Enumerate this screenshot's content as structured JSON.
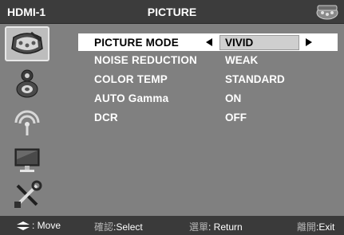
{
  "header": {
    "source": "HDMI-1",
    "title": "PICTURE"
  },
  "sidebar": {
    "items": [
      {
        "name": "picture",
        "icon": "palette-icon",
        "active": true
      },
      {
        "name": "sound",
        "icon": "speaker-icon",
        "active": false
      },
      {
        "name": "network",
        "icon": "broadcast-icon",
        "active": false
      },
      {
        "name": "display",
        "icon": "monitor-icon",
        "active": false
      },
      {
        "name": "setup",
        "icon": "tools-icon",
        "active": false
      }
    ]
  },
  "menu": {
    "items": [
      {
        "label": "PICTURE MODE",
        "value": "VIVID",
        "selected": true
      },
      {
        "label": "NOISE REDUCTION",
        "value": "WEAK",
        "selected": false
      },
      {
        "label": "COLOR TEMP",
        "value": "STANDARD",
        "selected": false
      },
      {
        "label": "AUTO Gamma",
        "value": "ON",
        "selected": false
      },
      {
        "label": "DCR",
        "value": "OFF",
        "selected": false
      }
    ]
  },
  "footer": {
    "move": ": Move",
    "select_key": "確認",
    "select": ":Select",
    "return_key": "選單",
    "return": ": Return",
    "exit_key": "離開",
    "exit": ":Exit"
  },
  "colors": {
    "panel": "#808080",
    "header": "#3c3c3c",
    "footer": "#3a3a3a",
    "highlight": "#ffffff",
    "value_box": "#cfcfcf"
  }
}
